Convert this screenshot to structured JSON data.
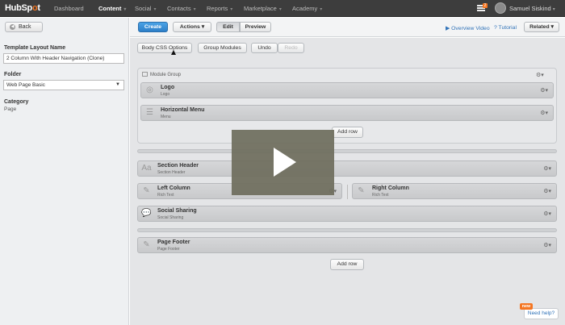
{
  "brand": {
    "logo_text_a": "HubSp",
    "logo_text_b": "o",
    "logo_text_c": "t"
  },
  "nav": {
    "items": [
      "Dashboard",
      "Content",
      "Social",
      "Contacts",
      "Reports",
      "Marketplace",
      "Academy"
    ],
    "active": "Content"
  },
  "user": {
    "name": "Samuel Siskind",
    "notif_count": "2"
  },
  "sidebar": {
    "back_label": "Back",
    "name_label": "Template Layout Name",
    "name_value": "2 Column With Header Navigation (Clone)",
    "folder_label": "Folder",
    "folder_value": "Web Page Basic",
    "category_label": "Category",
    "category_value": "Page"
  },
  "toolbar": {
    "create": "Create",
    "actions": "Actions",
    "edit": "Edit",
    "preview": "Preview",
    "overview_video": "Overview Video",
    "tutorial": "Tutorial",
    "related": "Related",
    "body_css": "Body CSS Options",
    "group_modules": "Group Modules",
    "undo": "Undo",
    "redo": "Redo"
  },
  "layout": {
    "module_group_label": "Module Group",
    "logo": {
      "title": "Logo",
      "sub": "Logo"
    },
    "menu": {
      "title": "Horizontal Menu",
      "sub": "Menu"
    },
    "add_row": "Add row",
    "section_header": {
      "title": "Section Header",
      "sub": "Section Header"
    },
    "left_column": {
      "title": "Left Column",
      "sub": "Rich Text"
    },
    "right_column": {
      "title": "Right Column",
      "sub": "Rich Text"
    },
    "social_sharing": {
      "title": "Social Sharing",
      "sub": "Social Sharing"
    },
    "page_footer": {
      "title": "Page Footer",
      "sub": "Page Footer"
    }
  },
  "help": {
    "new_badge": "new",
    "label": "Need help?"
  },
  "icons": {
    "back": "back-arrow-icon",
    "gear": "gear-icon",
    "module_group": "module-group-icon",
    "video": "play-icon",
    "tutorial": "help-circle-icon",
    "notifications": "notifications-icon"
  },
  "colors": {
    "accent": "#f47622",
    "primary": "#2d7fc8",
    "nav_bg": "#3d3d3d",
    "link": "#3173b8"
  }
}
